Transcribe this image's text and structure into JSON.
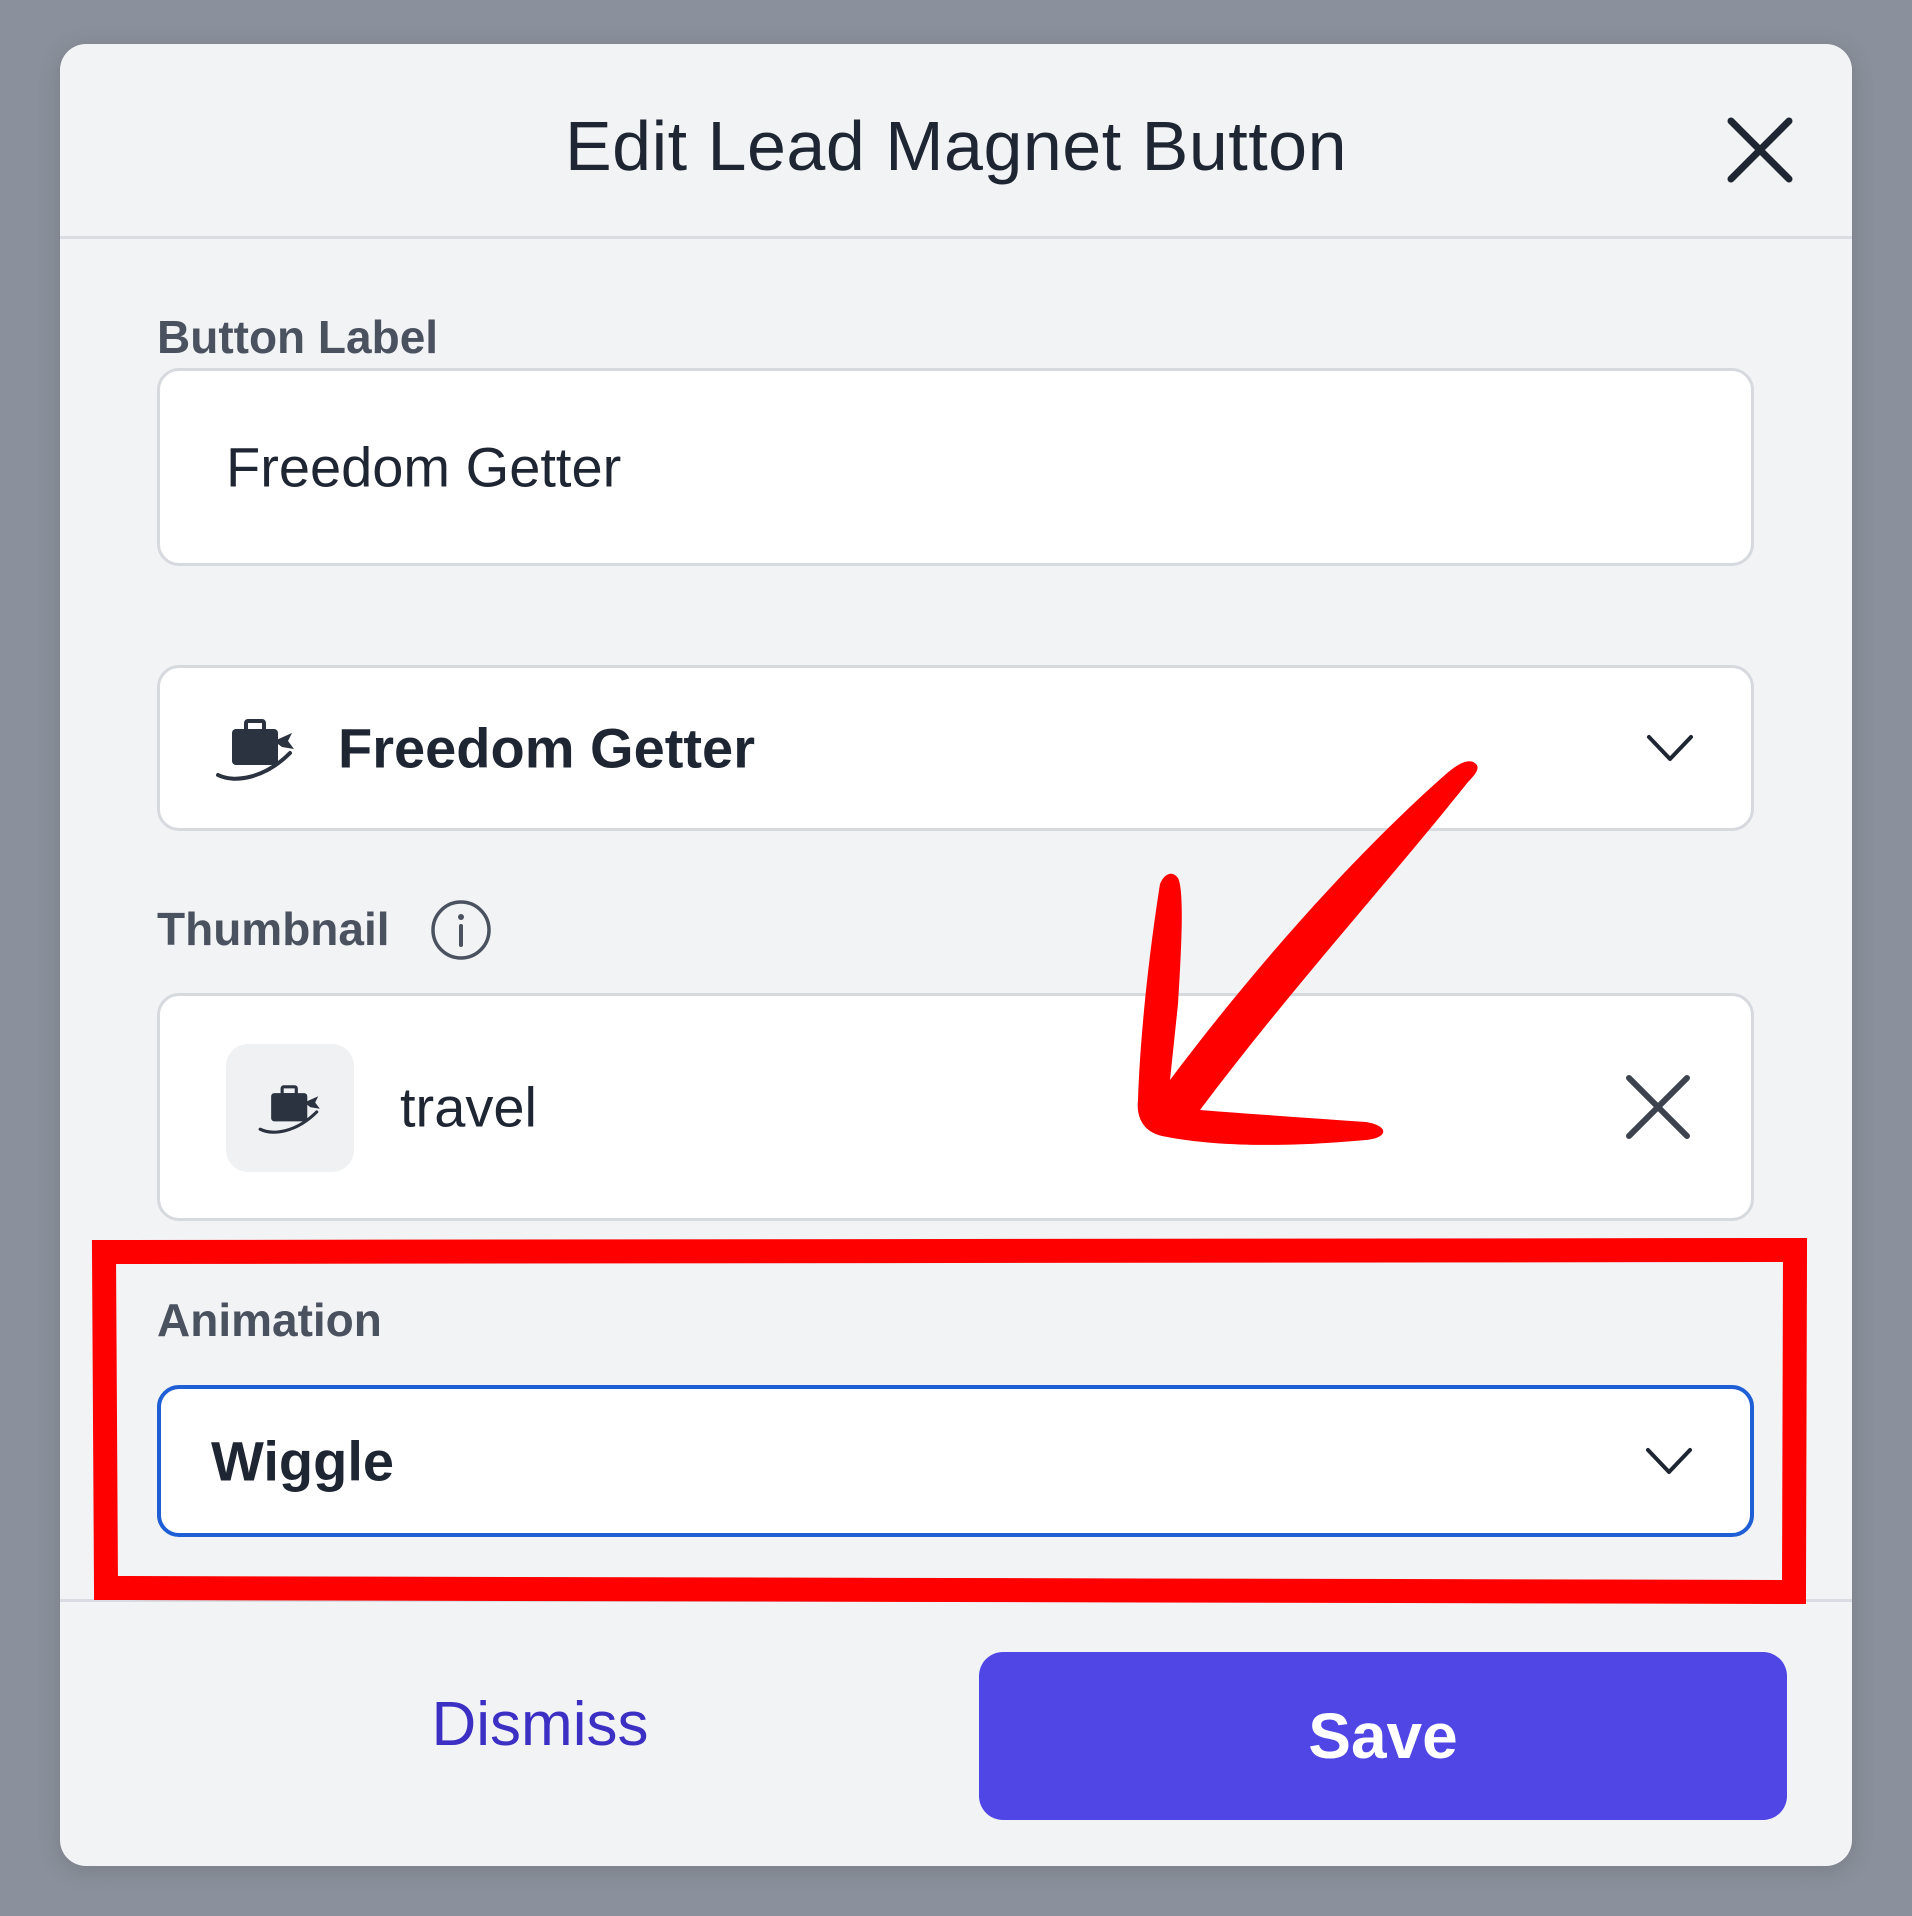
{
  "modal": {
    "title": "Edit Lead Magnet Button",
    "close_icon": "close-icon"
  },
  "button_label_field": {
    "label": "Button Label",
    "value": "Freedom Getter"
  },
  "lead_magnet_select": {
    "icon": "briefcase-plane-icon",
    "selected": "Freedom Getter"
  },
  "thumbnail": {
    "label": "Thumbnail",
    "info_icon": "info-icon",
    "file_name": "travel",
    "remove_icon": "close-icon"
  },
  "animation": {
    "label": "Animation",
    "selected": "Wiggle"
  },
  "footer": {
    "dismiss_label": "Dismiss",
    "save_label": "Save"
  },
  "colors": {
    "primary": "#4f46e5",
    "focus_border": "#1f5fd6",
    "annotation_red": "#ff0000",
    "backdrop": "#8b919c"
  }
}
